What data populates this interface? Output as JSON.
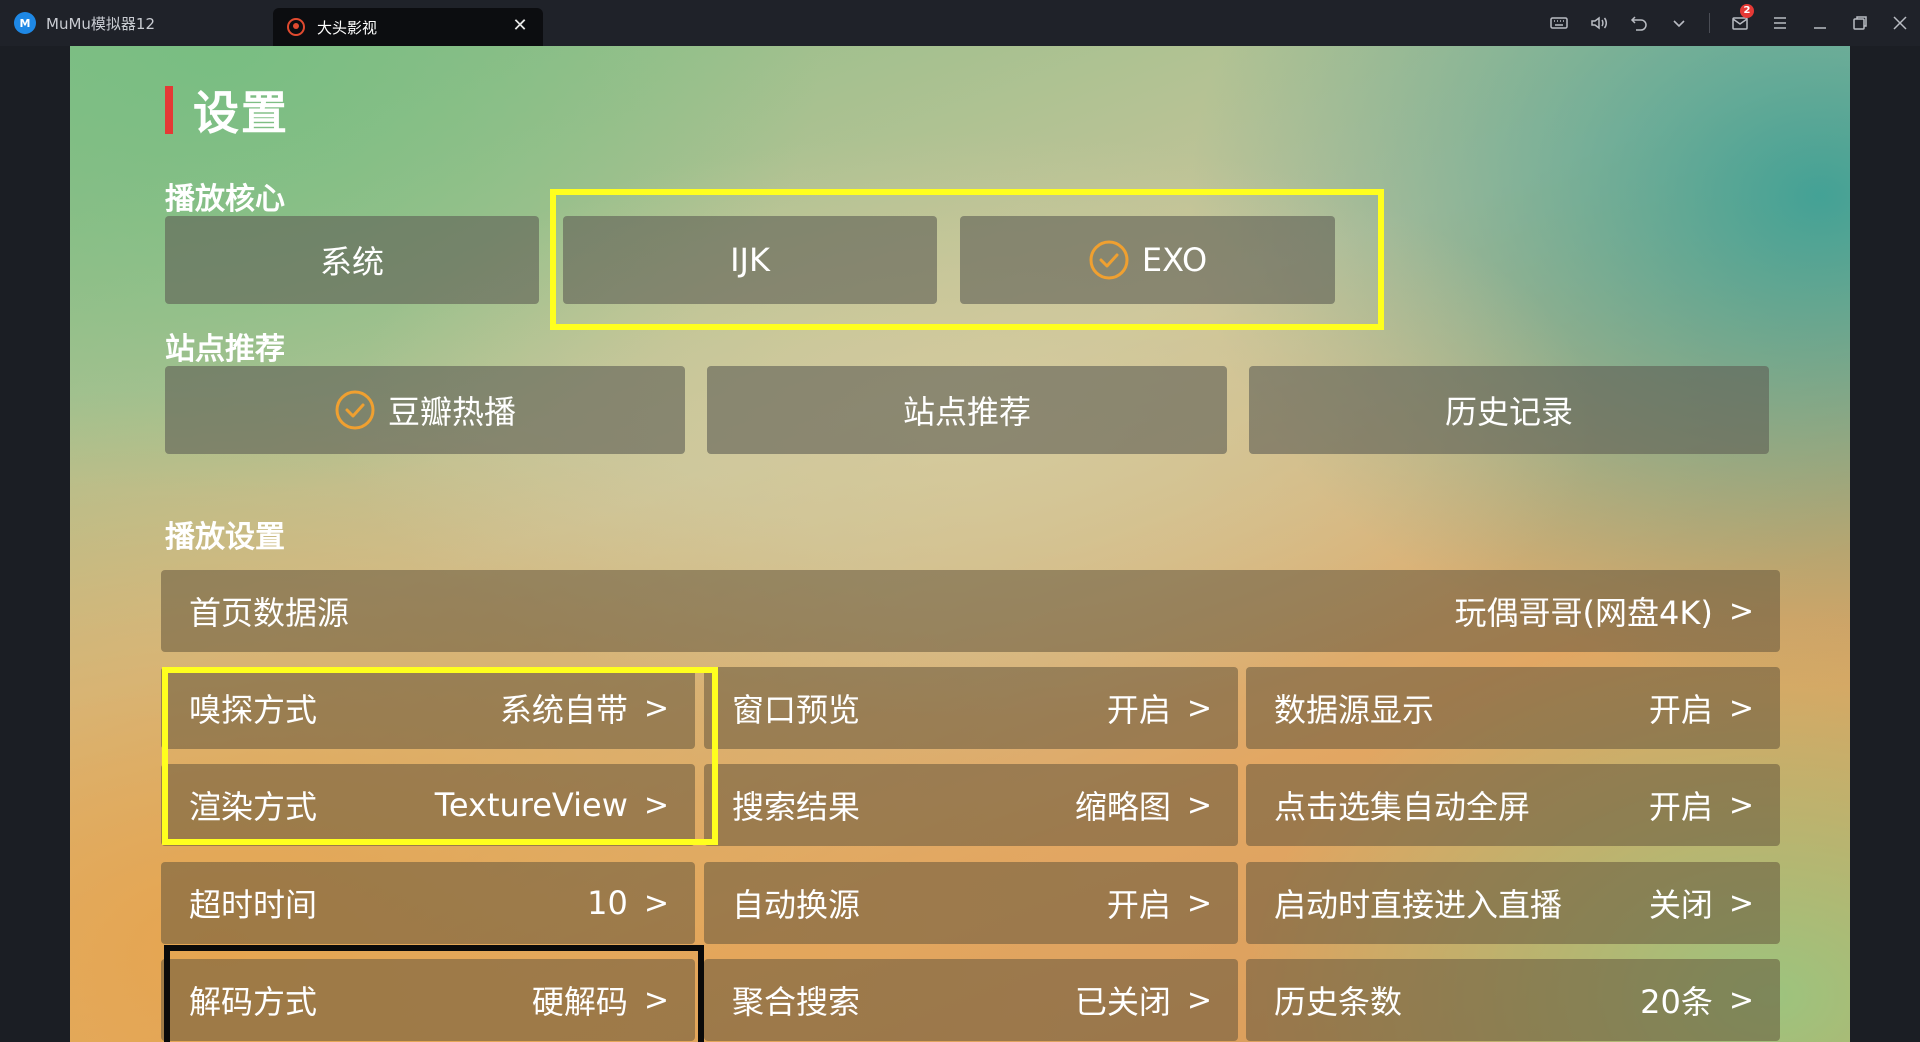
{
  "titlebar": {
    "app_title": "MuMu模拟器12",
    "logo_text": "M",
    "tab_title": "大头影视",
    "tab_close": "✕",
    "mail_badge": "2",
    "icons": [
      "keyboard-icon",
      "volume-icon",
      "undo-icon",
      "chevron-down-icon",
      "mail-icon",
      "menu-icon",
      "minimize-icon",
      "restore-icon",
      "close-icon"
    ]
  },
  "settings": {
    "title": "设置",
    "accent_color": "#e53935",
    "check_color": "#f0a030",
    "player_core": {
      "label": "播放核心",
      "options": [
        "系统",
        "IJK",
        "EXO"
      ],
      "selected": "EXO"
    },
    "site_recommend": {
      "label": "站点推荐",
      "options": [
        "豆瓣热播",
        "站点推荐",
        "历史记录"
      ],
      "selected": "豆瓣热播"
    },
    "playback": {
      "label": "播放设置",
      "home_source": {
        "label": "首页数据源",
        "value": "玩偶哥哥(网盘4K)"
      },
      "items": [
        {
          "label": "嗅探方式",
          "value": "系统自带"
        },
        {
          "label": "窗口预览",
          "value": "开启"
        },
        {
          "label": "数据源显示",
          "value": "开启"
        },
        {
          "label": "渲染方式",
          "value": "TextureView"
        },
        {
          "label": "搜索结果",
          "value": "缩略图"
        },
        {
          "label": "点击选集自动全屏",
          "value": "开启"
        },
        {
          "label": "超时时间",
          "value": "10"
        },
        {
          "label": "自动换源",
          "value": "开启"
        },
        {
          "label": "启动时直接进入直播",
          "value": "关闭"
        },
        {
          "label": "解码方式",
          "value": "硬解码"
        },
        {
          "label": "聚合搜索",
          "value": "已关闭"
        },
        {
          "label": "历史条数",
          "value": "20条"
        }
      ],
      "arrow": ">"
    }
  }
}
